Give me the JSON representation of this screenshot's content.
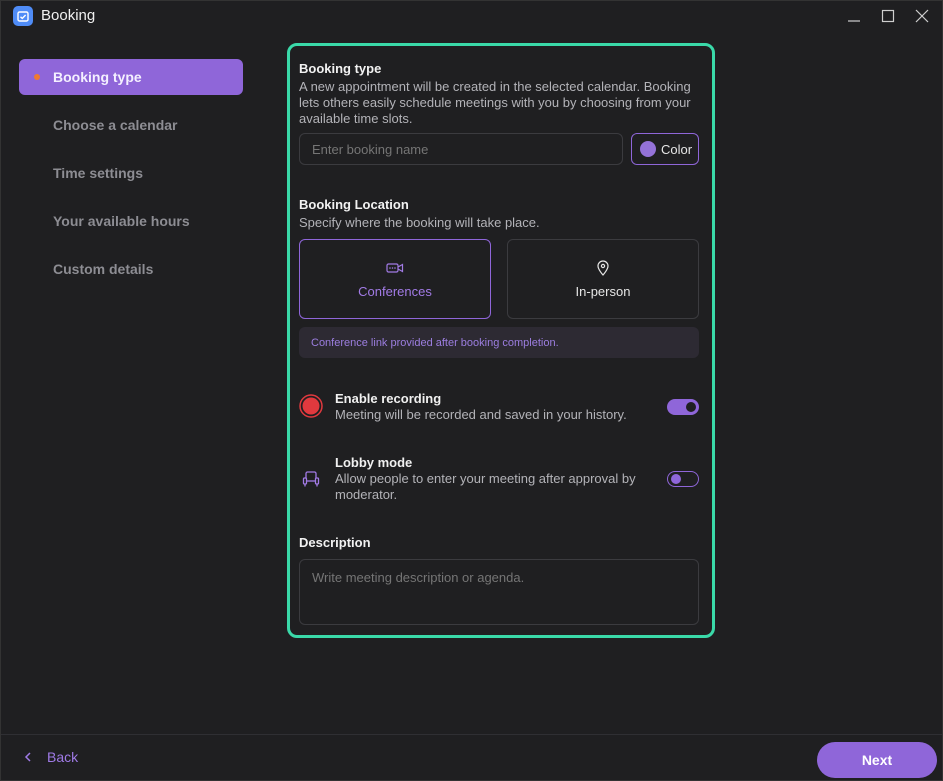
{
  "window": {
    "title": "Booking",
    "icon": "calendar-icon"
  },
  "sidebar": {
    "items": [
      {
        "label": "Booking type",
        "active": true
      },
      {
        "label": "Choose a calendar",
        "active": false
      },
      {
        "label": "Time settings",
        "active": false
      },
      {
        "label": "Your available hours",
        "active": false
      },
      {
        "label": "Custom details",
        "active": false
      }
    ]
  },
  "booking_type": {
    "title": "Booking type",
    "description": "A new appointment will be created in the selected calendar. Booking lets others easily schedule meetings with you by choosing from your available time slots.",
    "name_placeholder": "Enter booking name",
    "color_label": "Color",
    "color_value": "#9472d8"
  },
  "location": {
    "title": "Booking Location",
    "description": "Specify where the booking will take place.",
    "options": [
      {
        "label": "Conferences",
        "icon": "video-camera-icon",
        "selected": true
      },
      {
        "label": "In-person",
        "icon": "map-pin-icon",
        "selected": false
      }
    ],
    "info": "Conference link provided after booking completion."
  },
  "recording": {
    "title": "Enable recording",
    "description": "Meeting will be recorded and saved in your history.",
    "enabled": true,
    "icon": "record-icon"
  },
  "lobby": {
    "title": "Lobby mode",
    "description": "Allow people to enter your meeting after approval by moderator.",
    "enabled": false,
    "icon": "armchair-icon"
  },
  "description": {
    "title": "Description",
    "placeholder": "Write meeting description or agenda."
  },
  "footer": {
    "back_label": "Back",
    "next_label": "Next"
  },
  "colors": {
    "accent": "#8f66d9",
    "panel_border": "#3ad9a9",
    "background": "#1f1f21",
    "record_red": "#e0393e",
    "active_dot": "#f07a2e"
  }
}
